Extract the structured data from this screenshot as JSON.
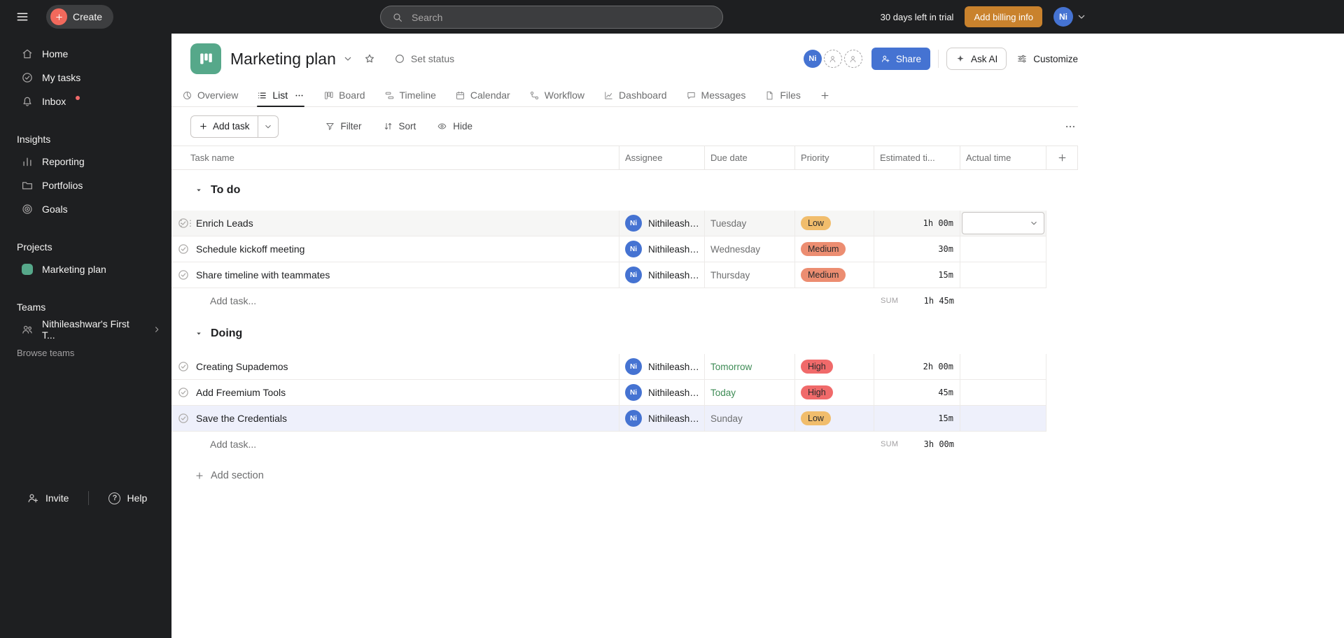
{
  "topbar": {
    "create": "Create",
    "search_placeholder": "Search",
    "trial": "30 days left in trial",
    "billing": "Add billing info",
    "avatar": "Ni"
  },
  "sidebar": {
    "main": [
      {
        "label": "Home"
      },
      {
        "label": "My tasks"
      },
      {
        "label": "Inbox"
      }
    ],
    "insights": {
      "header": "Insights",
      "items": [
        {
          "label": "Reporting"
        },
        {
          "label": "Portfolios"
        },
        {
          "label": "Goals"
        }
      ]
    },
    "projects": {
      "header": "Projects",
      "items": [
        {
          "label": "Marketing plan"
        }
      ]
    },
    "teams": {
      "header": "Teams",
      "items": [
        {
          "label": "Nithileashwar's First T..."
        }
      ],
      "browse": "Browse teams"
    },
    "footer": {
      "invite": "Invite",
      "help": "Help"
    }
  },
  "header": {
    "title": "Marketing plan",
    "set_status": "Set status",
    "avatar": "Ni",
    "share": "Share",
    "ask_ai": "Ask AI",
    "customize": "Customize"
  },
  "tabs": [
    {
      "label": "Overview"
    },
    {
      "label": "List"
    },
    {
      "label": "Board"
    },
    {
      "label": "Timeline"
    },
    {
      "label": "Calendar"
    },
    {
      "label": "Workflow"
    },
    {
      "label": "Dashboard"
    },
    {
      "label": "Messages"
    },
    {
      "label": "Files"
    }
  ],
  "toolbar": {
    "add_task": "Add task",
    "filter": "Filter",
    "sort": "Sort",
    "hide": "Hide"
  },
  "table": {
    "columns": [
      "Task name",
      "Assignee",
      "Due date",
      "Priority",
      "Estimated ti...",
      "Actual time"
    ],
    "green_dues": [
      "Today",
      "Tomorrow"
    ],
    "sections": [
      {
        "name": "To do",
        "tasks": [
          {
            "name": "Enrich Leads",
            "avatar": "Ni",
            "assignee": "Nithileashwar",
            "due": "Tuesday",
            "priority": "Low",
            "estimated": "1h 00m",
            "actual": ""
          },
          {
            "name": "Schedule kickoff meeting",
            "avatar": "Ni",
            "assignee": "Nithileashwar",
            "due": "Wednesday",
            "priority": "Medium",
            "estimated": "30m",
            "actual": ""
          },
          {
            "name": "Share timeline with teammates",
            "avatar": "Ni",
            "assignee": "Nithileashwar",
            "due": "Thursday",
            "priority": "Medium",
            "estimated": "15m",
            "actual": ""
          }
        ],
        "add_task": "Add task...",
        "sum_label": "SUM",
        "sum_value": "1h 45m"
      },
      {
        "name": "Doing",
        "tasks": [
          {
            "name": "Creating Supademos",
            "avatar": "Ni",
            "assignee": "Nithileashwar",
            "due": "Tomorrow",
            "priority": "High",
            "estimated": "2h 00m",
            "actual": ""
          },
          {
            "name": "Add Freemium Tools",
            "avatar": "Ni",
            "assignee": "Nithileashwar",
            "due": "Today",
            "priority": "High",
            "estimated": "45m",
            "actual": ""
          },
          {
            "name": "Save the Credentials",
            "avatar": "Ni",
            "assignee": "Nithileashwar",
            "due": "Sunday",
            "priority": "Low",
            "estimated": "15m",
            "actual": ""
          }
        ],
        "add_task": "Add task...",
        "sum_label": "SUM",
        "sum_value": "3h 00m"
      }
    ],
    "add_section": "Add section"
  },
  "colors": {
    "accent_blue": "#4573d2",
    "project_color": "#56a88a",
    "billing_gold": "#c9822d",
    "create_button_coral": "#f2695c",
    "notification_dot": "#f06a6a",
    "due_green": "#3d8b55",
    "selected_row": "#eef0fb",
    "priority": {
      "low": "#f1bd6c",
      "medium": "#ec8d71",
      "high": "#f06a6a"
    }
  }
}
